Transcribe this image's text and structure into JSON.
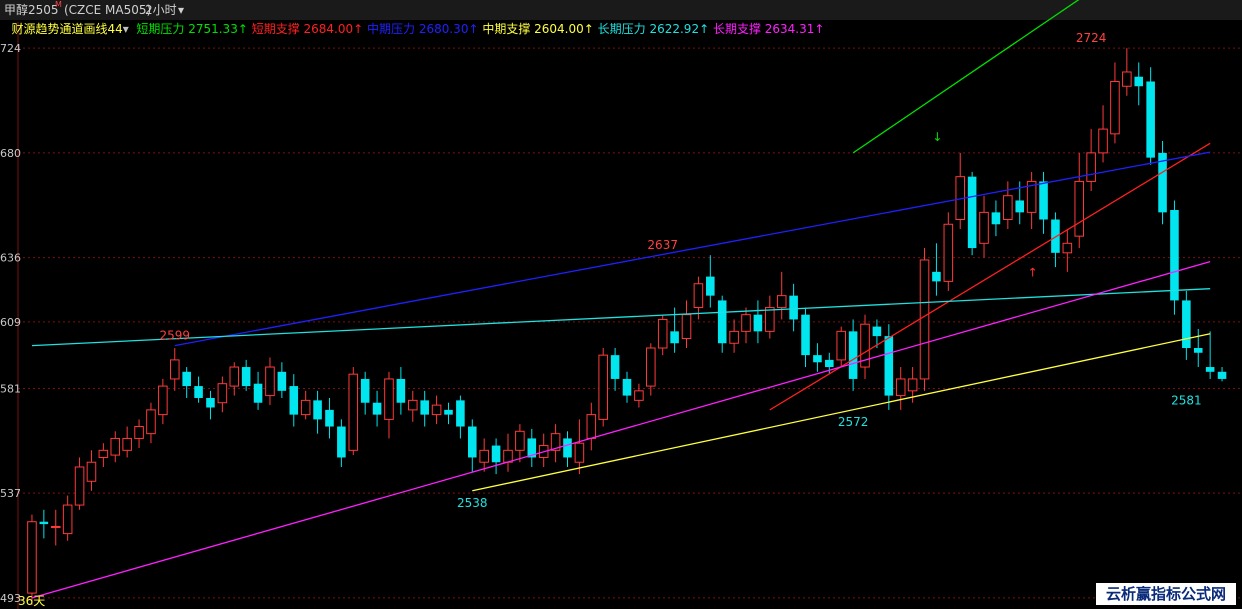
{
  "header": {
    "symbol_name": "甲醇2505",
    "symbol_flag": "M",
    "contract": "(CZCE MA505)",
    "period": "2小时",
    "period_arrow": "▾"
  },
  "legend": {
    "indicator": "财源趋势通道画线44",
    "indicator_arrow": "▾",
    "items": [
      {
        "label": "短期压力",
        "value": "2751.33",
        "arrow": "↑",
        "color": "#00e000"
      },
      {
        "label": "短期支撑",
        "value": "2684.00",
        "arrow": "↑",
        "color": "#ff2020"
      },
      {
        "label": "中期压力",
        "value": "2680.30",
        "arrow": "↑",
        "color": "#2020ff"
      },
      {
        "label": "中期支撑",
        "value": "2604.00",
        "arrow": "↑",
        "color": "#ffff40"
      },
      {
        "label": "长期压力",
        "value": "2622.92",
        "arrow": "↑",
        "color": "#20e0e0"
      },
      {
        "label": "长期支撑",
        "value": "2634.31",
        "arrow": "↑",
        "color": "#ff20ff"
      }
    ]
  },
  "footer": {
    "days_label": "36天"
  },
  "watermark": {
    "text": "云析赢指标公式网"
  },
  "colors": {
    "up": "#ff3a3a",
    "down": "#00e5ee",
    "grid": "#7a1010",
    "background": "#000000"
  },
  "chart_data": {
    "type": "candlestick",
    "y_ticks": [
      "724",
      "680",
      "636",
      "609",
      "581",
      "537",
      "493"
    ],
    "y_tick_values": [
      2724,
      2680,
      2636,
      2609,
      2581,
      2537,
      2493
    ],
    "ylim": [
      2490,
      2735
    ],
    "annotations": [
      {
        "text": "2599",
        "bar": 12,
        "value": 2599,
        "color": "#ff4040",
        "pos": "above"
      },
      {
        "text": "2538",
        "bar": 37,
        "value": 2538,
        "color": "#20e0e0",
        "pos": "below"
      },
      {
        "text": "2637",
        "bar": 53,
        "value": 2637,
        "color": "#ff4040",
        "pos": "above"
      },
      {
        "text": "2572",
        "bar": 69,
        "value": 2572,
        "color": "#20e0e0",
        "pos": "below"
      },
      {
        "text": "2724",
        "bar": 89,
        "value": 2724,
        "color": "#ff4040",
        "pos": "above"
      },
      {
        "text": "2581",
        "bar": 97,
        "value": 2581,
        "color": "#20e0e0",
        "pos": "below"
      }
    ],
    "candles": [
      [
        2495,
        2525,
        2490,
        2528
      ],
      [
        2525,
        2524,
        2518,
        2530
      ],
      [
        2523,
        2523,
        2515,
        2530
      ],
      [
        2520,
        2532,
        2517,
        2536
      ],
      [
        2532,
        2548,
        2530,
        2552
      ],
      [
        2542,
        2550,
        2538,
        2555
      ],
      [
        2552,
        2555,
        2548,
        2558
      ],
      [
        2553,
        2560,
        2550,
        2563
      ],
      [
        2555,
        2560,
        2552,
        2565
      ],
      [
        2560,
        2565,
        2556,
        2568
      ],
      [
        2562,
        2572,
        2558,
        2575
      ],
      [
        2570,
        2582,
        2566,
        2585
      ],
      [
        2585,
        2593,
        2580,
        2598
      ],
      [
        2588,
        2582,
        2577,
        2590
      ],
      [
        2582,
        2577,
        2575,
        2586
      ],
      [
        2577,
        2573,
        2568,
        2580
      ],
      [
        2575,
        2583,
        2571,
        2586
      ],
      [
        2582,
        2590,
        2578,
        2592
      ],
      [
        2590,
        2582,
        2580,
        2593
      ],
      [
        2583,
        2575,
        2572,
        2588
      ],
      [
        2578,
        2590,
        2574,
        2594
      ],
      [
        2588,
        2580,
        2577,
        2592
      ],
      [
        2582,
        2570,
        2565,
        2587
      ],
      [
        2570,
        2576,
        2568,
        2580
      ],
      [
        2576,
        2568,
        2562,
        2580
      ],
      [
        2572,
        2565,
        2560,
        2577
      ],
      [
        2565,
        2552,
        2548,
        2568
      ],
      [
        2555,
        2587,
        2553,
        2590
      ],
      [
        2585,
        2575,
        2570,
        2588
      ],
      [
        2575,
        2570,
        2565,
        2580
      ],
      [
        2568,
        2585,
        2560,
        2588
      ],
      [
        2585,
        2575,
        2570,
        2590
      ],
      [
        2572,
        2576,
        2567,
        2580
      ],
      [
        2576,
        2570,
        2565,
        2580
      ],
      [
        2570,
        2574,
        2566,
        2578
      ],
      [
        2572,
        2570,
        2566,
        2575
      ],
      [
        2576,
        2565,
        2560,
        2578
      ],
      [
        2565,
        2552,
        2546,
        2568
      ],
      [
        2550,
        2555,
        2546,
        2560
      ],
      [
        2557,
        2550,
        2545,
        2560
      ],
      [
        2550,
        2555,
        2546,
        2562
      ],
      [
        2555,
        2563,
        2550,
        2566
      ],
      [
        2560,
        2552,
        2548,
        2564
      ],
      [
        2552,
        2557,
        2548,
        2562
      ],
      [
        2555,
        2562,
        2550,
        2566
      ],
      [
        2560,
        2552,
        2548,
        2563
      ],
      [
        2550,
        2558,
        2545,
        2568
      ],
      [
        2560,
        2570,
        2555,
        2575
      ],
      [
        2568,
        2595,
        2565,
        2598
      ],
      [
        2595,
        2585,
        2580,
        2598
      ],
      [
        2585,
        2578,
        2575,
        2588
      ],
      [
        2576,
        2580,
        2573,
        2583
      ],
      [
        2582,
        2598,
        2578,
        2600
      ],
      [
        2598,
        2610,
        2595,
        2612
      ],
      [
        2605,
        2600,
        2596,
        2615
      ],
      [
        2602,
        2612,
        2598,
        2618
      ],
      [
        2615,
        2625,
        2610,
        2628
      ],
      [
        2628,
        2620,
        2615,
        2637
      ],
      [
        2618,
        2600,
        2596,
        2620
      ],
      [
        2600,
        2605,
        2596,
        2610
      ],
      [
        2605,
        2612,
        2600,
        2615
      ],
      [
        2612,
        2605,
        2600,
        2618
      ],
      [
        2605,
        2615,
        2602,
        2620
      ],
      [
        2615,
        2620,
        2610,
        2630
      ],
      [
        2620,
        2610,
        2605,
        2625
      ],
      [
        2612,
        2595,
        2590,
        2615
      ],
      [
        2595,
        2592,
        2588,
        2600
      ],
      [
        2593,
        2590,
        2587,
        2596
      ],
      [
        2593,
        2605,
        2590,
        2607
      ],
      [
        2605,
        2585,
        2580,
        2610
      ],
      [
        2590,
        2608,
        2585,
        2612
      ],
      [
        2607,
        2603,
        2598,
        2610
      ],
      [
        2603,
        2578,
        2572,
        2608
      ],
      [
        2578,
        2585,
        2572,
        2590
      ],
      [
        2580,
        2585,
        2575,
        2590
      ],
      [
        2585,
        2635,
        2580,
        2640
      ],
      [
        2630,
        2626,
        2620,
        2642
      ],
      [
        2626,
        2650,
        2622,
        2655
      ],
      [
        2652,
        2670,
        2648,
        2680
      ],
      [
        2670,
        2640,
        2637,
        2672
      ],
      [
        2642,
        2655,
        2636,
        2662
      ],
      [
        2655,
        2650,
        2645,
        2660
      ],
      [
        2652,
        2662,
        2648,
        2668
      ],
      [
        2660,
        2655,
        2650,
        2668
      ],
      [
        2655,
        2668,
        2648,
        2672
      ],
      [
        2668,
        2652,
        2646,
        2672
      ],
      [
        2652,
        2638,
        2632,
        2655
      ],
      [
        2638,
        2642,
        2630,
        2648
      ],
      [
        2645,
        2668,
        2640,
        2680
      ],
      [
        2668,
        2680,
        2664,
        2690
      ],
      [
        2680,
        2690,
        2676,
        2700
      ],
      [
        2688,
        2710,
        2684,
        2718
      ],
      [
        2708,
        2714,
        2704,
        2724
      ],
      [
        2712,
        2708,
        2700,
        2718
      ],
      [
        2710,
        2678,
        2675,
        2716
      ],
      [
        2680,
        2655,
        2650,
        2685
      ],
      [
        2656,
        2618,
        2612,
        2660
      ],
      [
        2618,
        2598,
        2593,
        2622
      ],
      [
        2598,
        2596,
        2590,
        2606
      ],
      [
        2590,
        2588,
        2585,
        2605
      ],
      [
        2588,
        2585,
        2584,
        2590
      ]
    ],
    "lines": [
      {
        "name": "短期压力",
        "color": "#00e000",
        "from": [
          69,
          2680
        ],
        "to": [
          90,
          2751.33
        ]
      },
      {
        "name": "短期支撑",
        "color": "#ff2020",
        "from": [
          62,
          2572
        ],
        "to": [
          99,
          2684.0
        ]
      },
      {
        "name": "中期压力",
        "color": "#2020ff",
        "from": [
          12,
          2599
        ],
        "to": [
          99,
          2680.3
        ]
      },
      {
        "name": "中期支撑",
        "color": "#ffff40",
        "from": [
          37,
          2538
        ],
        "to": [
          99,
          2604.0
        ]
      },
      {
        "name": "长期压力",
        "color": "#20e0e0",
        "from": [
          0,
          2599
        ],
        "to": [
          99,
          2622.92
        ]
      },
      {
        "name": "长期支撑",
        "color": "#ff20ff",
        "from": [
          0,
          2493
        ],
        "to": [
          99,
          2634.31
        ]
      }
    ]
  }
}
